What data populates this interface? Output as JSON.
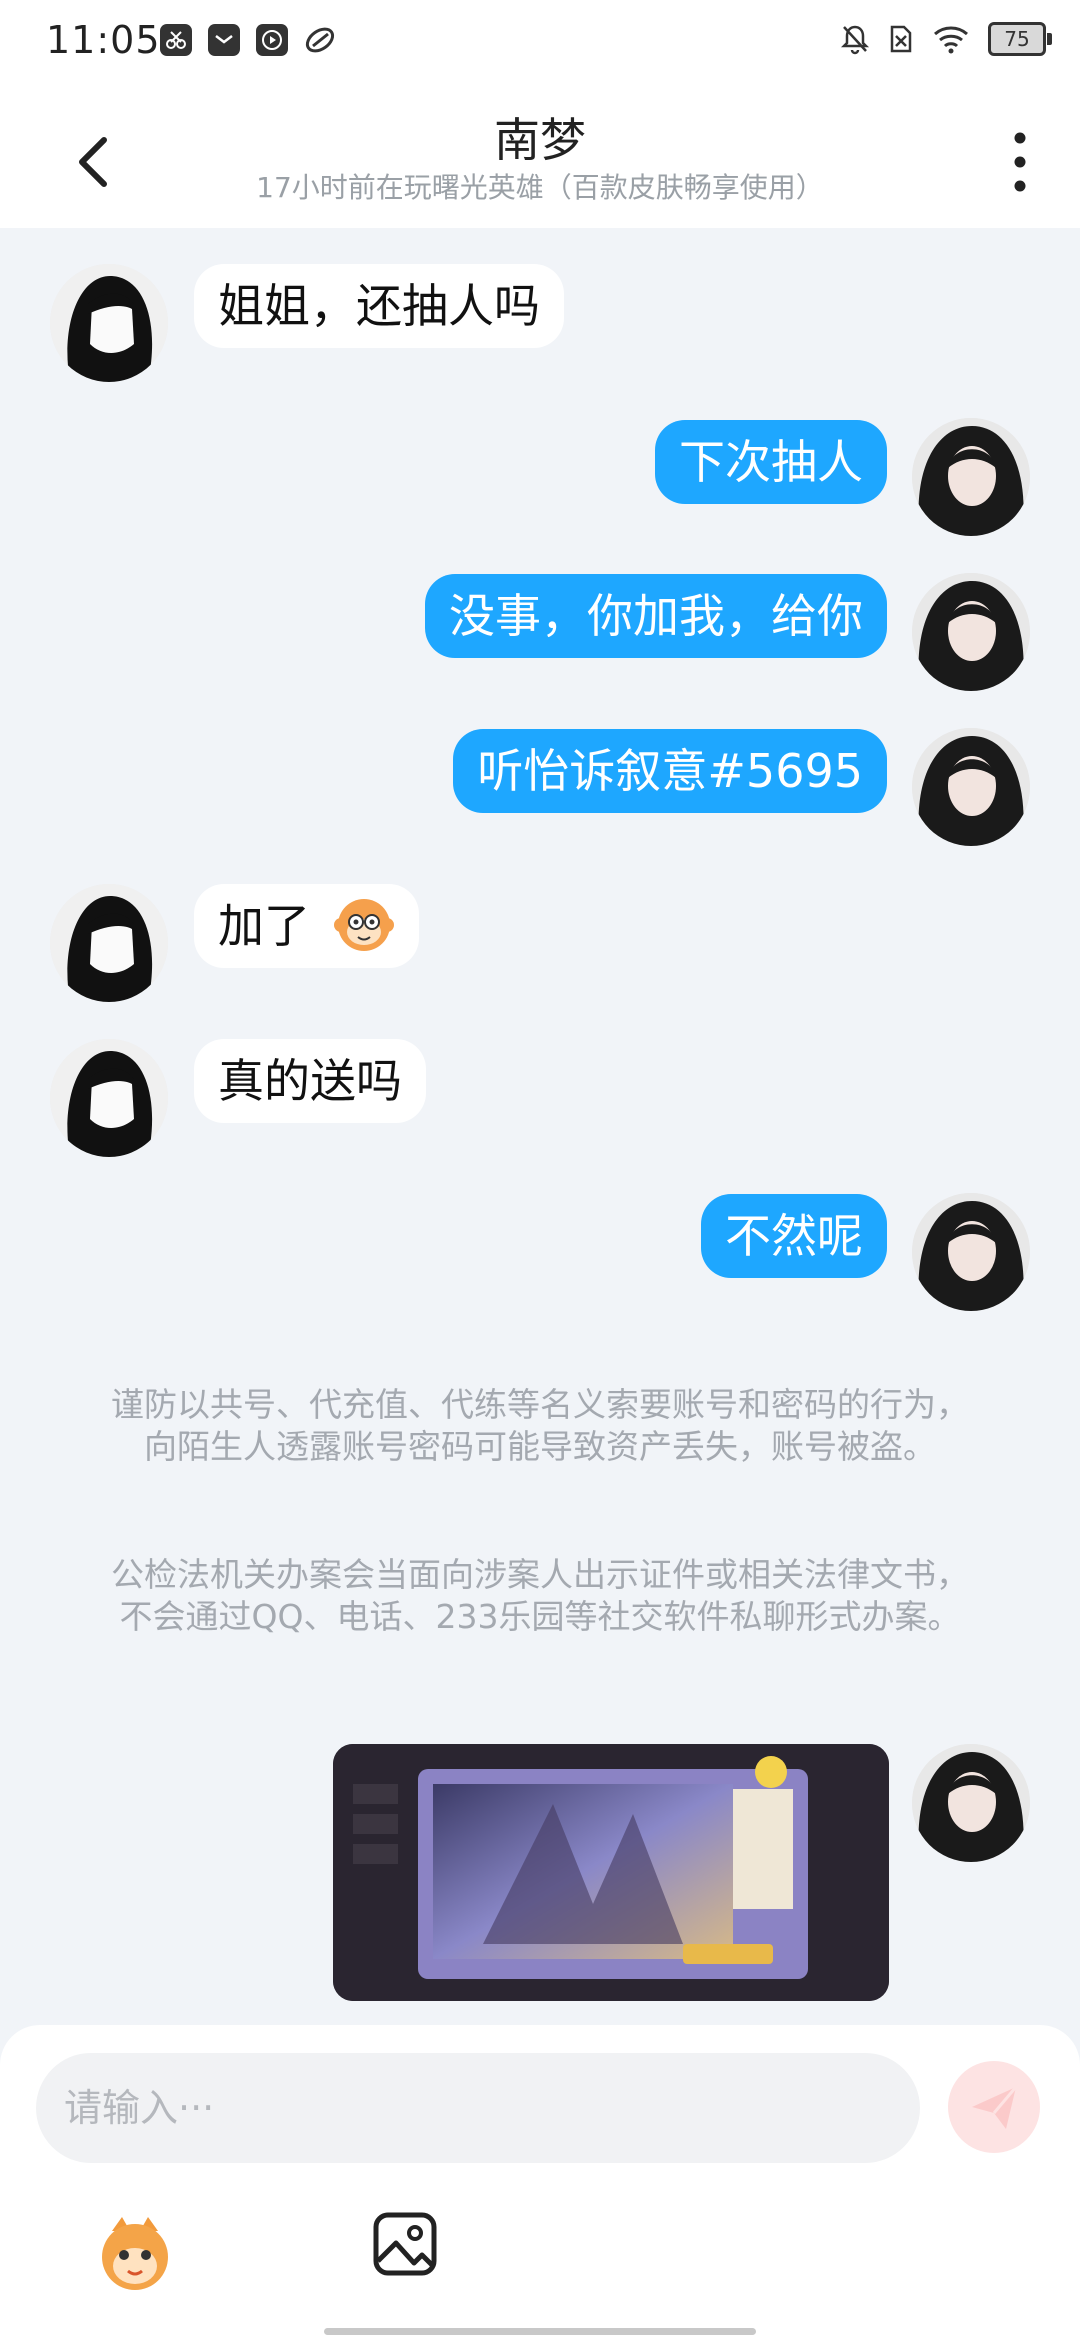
{
  "status_bar": {
    "time": "11:05",
    "battery": "75",
    "icons": [
      "scissors-app-icon",
      "mail-app-icon",
      "video-app-icon",
      "leaf-app-icon",
      "bell-off-icon",
      "sim-off-icon",
      "wifi-icon",
      "battery-icon"
    ]
  },
  "header": {
    "title": "南梦",
    "subtitle": "17小时前在玩曙光英雄（百款皮肤畅享使用）",
    "icons": [
      "back-arrow-icon",
      "more-vertical-icon"
    ]
  },
  "messages": [
    {
      "side": "left",
      "text": "姐姐，还抽人吗"
    },
    {
      "side": "right",
      "text": "下次抽人"
    },
    {
      "side": "right",
      "text": "没事，你加我，给你"
    },
    {
      "side": "right",
      "text": "听怡诉叙意#5695"
    },
    {
      "side": "left",
      "text": "加了",
      "emoji": "monkey-emoji-icon"
    },
    {
      "side": "left",
      "text": "真的送吗"
    },
    {
      "side": "right",
      "text": "不然呢"
    }
  ],
  "notice": {
    "p1": "谨防以共号、代充值、代练等名义索要账号和密码的行为，向陌生人透露账号密码可能导致资产丢失，账号被盗。",
    "p2": "公检法机关办案会当面向涉案人出示证件或相关法律文书，不会通过QQ、电话、233乐园等社交软件私聊形式办案。"
  },
  "image_message": {
    "side": "right",
    "description_icon": "game-screenshot-image"
  },
  "input": {
    "placeholder": "请输入···",
    "icons": [
      "send-icon",
      "emoji-sticker-icon",
      "image-picker-icon"
    ]
  },
  "colors": {
    "bubble_right": "#1ea7ff",
    "bubble_left": "#ffffff",
    "background": "#f1f4f8"
  }
}
